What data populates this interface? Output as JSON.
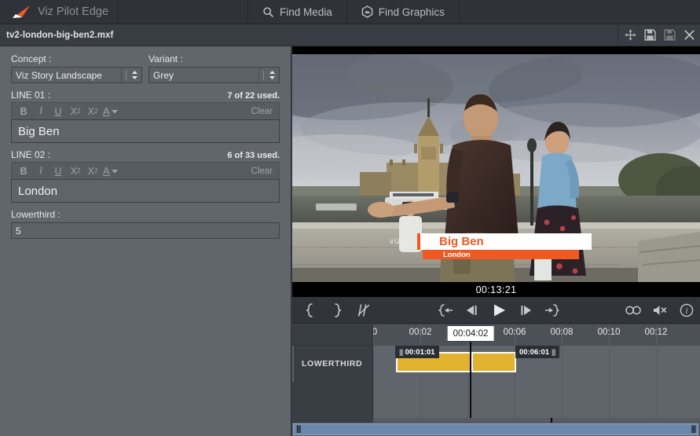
{
  "app": {
    "brand": "Viz Pilot Edge",
    "logo_icon": "vizrt-arrow-logo",
    "tabs": [
      {
        "label": "Find Media",
        "icon": "search-icon"
      },
      {
        "label": "Find Graphics",
        "icon": "graphics-hex-icon"
      }
    ]
  },
  "document": {
    "title": "tv2-london-big-ben2.mxf",
    "tools": [
      {
        "name": "move-icon",
        "enabled": true
      },
      {
        "name": "save-icon",
        "enabled": true
      },
      {
        "name": "save-as-icon",
        "enabled": false
      },
      {
        "name": "close-icon",
        "enabled": true
      }
    ]
  },
  "form": {
    "concept": {
      "label": "Concept :",
      "value": "Viz Story Landscape"
    },
    "variant": {
      "label": "Variant :",
      "value": "Grey"
    },
    "format_buttons": [
      {
        "name": "bold-icon",
        "label": "B"
      },
      {
        "name": "italic-icon",
        "label": "I"
      },
      {
        "name": "underline-icon",
        "label": "U"
      },
      {
        "name": "subscript-icon",
        "label": "X"
      },
      {
        "name": "superscript-icon",
        "label": "X"
      },
      {
        "name": "font-color-icon",
        "label": "A"
      }
    ],
    "clear_label": "Clear",
    "lines": [
      {
        "label": "LINE 01 :",
        "count": "7 of 22 used.",
        "value": "Big Ben"
      },
      {
        "label": "LINE 02 :",
        "count": "6 of 33 used.",
        "value": "London"
      }
    ],
    "lowerthird": {
      "label": "Lowerthird :",
      "value": "5"
    }
  },
  "video": {
    "timecode": "00:13:21",
    "overlay": {
      "logo": "vizrt",
      "title": "Big Ben",
      "subtitle": "London",
      "title_color": "#ef5a23",
      "bar_color": "#f05a22"
    }
  },
  "transport": {
    "left_buttons": [
      {
        "name": "mark-in-icon"
      },
      {
        "name": "mark-out-icon"
      },
      {
        "name": "clear-marks-icon"
      }
    ],
    "center_buttons": [
      {
        "name": "go-to-in-point-icon"
      },
      {
        "name": "step-back-icon"
      },
      {
        "name": "play-icon"
      },
      {
        "name": "step-forward-icon"
      },
      {
        "name": "go-to-out-point-icon"
      }
    ],
    "right_buttons": [
      {
        "name": "loop-icon"
      },
      {
        "name": "mute-icon"
      },
      {
        "name": "info-icon"
      }
    ]
  },
  "timeline": {
    "track_name": "LOWERTHIRD",
    "ruler_labels": [
      "0",
      "00:02",
      "00:04:02",
      "00:06",
      "00:08",
      "00:10",
      "00:12"
    ],
    "playhead": "00:04:02",
    "mark_in": "00:01:01",
    "mark_out": "00:06:01",
    "clip_color": "#e0b22e"
  }
}
